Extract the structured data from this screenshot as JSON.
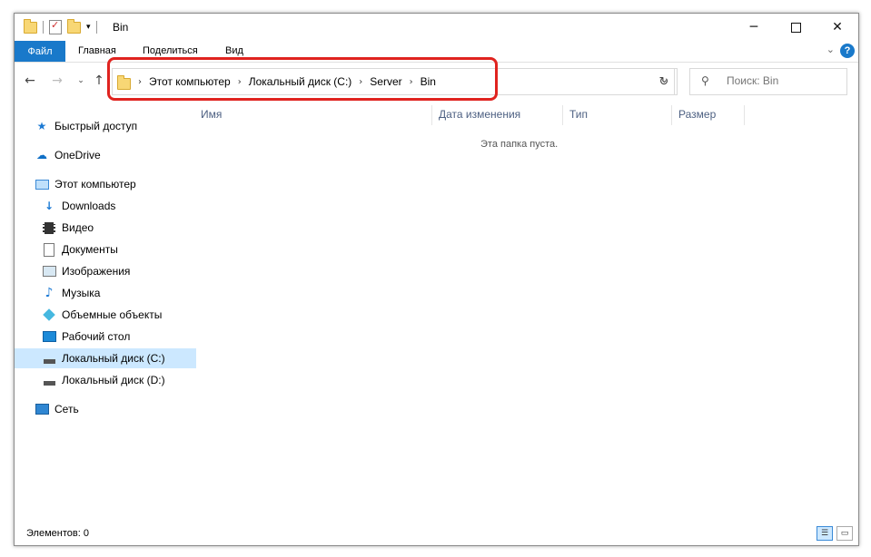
{
  "window": {
    "title": "Bin",
    "minimize_icon": "minimize-icon",
    "maximize_icon": "maximize-icon",
    "close_icon": "close-icon"
  },
  "ribbon": {
    "file_tab": "Файл",
    "tabs": [
      "Главная",
      "Поделиться",
      "Вид"
    ],
    "help_label": "?"
  },
  "address": {
    "crumbs": [
      "Этот компьютер",
      "Локальный диск (C:)",
      "Server",
      "Bin"
    ]
  },
  "search": {
    "placeholder": "Поиск: Bin"
  },
  "sidebar": {
    "items": [
      {
        "label": "Быстрый доступ",
        "icon": "star-icon"
      },
      {
        "label": "OneDrive",
        "icon": "cloud-icon"
      },
      {
        "label": "Этот компьютер",
        "icon": "computer-icon"
      },
      {
        "label": "Downloads",
        "icon": "download-icon"
      },
      {
        "label": "Видео",
        "icon": "video-icon"
      },
      {
        "label": "Документы",
        "icon": "document-icon"
      },
      {
        "label": "Изображения",
        "icon": "pictures-icon"
      },
      {
        "label": "Музыка",
        "icon": "music-icon"
      },
      {
        "label": "Объемные объекты",
        "icon": "3d-objects-icon"
      },
      {
        "label": "Рабочий стол",
        "icon": "desktop-icon"
      },
      {
        "label": "Локальный диск (C:)",
        "icon": "drive-icon",
        "selected": true
      },
      {
        "label": "Локальный диск (D:)",
        "icon": "drive-icon"
      },
      {
        "label": "Сеть",
        "icon": "network-icon"
      }
    ]
  },
  "columns": [
    "Имя",
    "Дата изменения",
    "Тип",
    "Размер"
  ],
  "content": {
    "empty_message": "Эта папка пуста."
  },
  "status": {
    "items_label": "Элементов: 0"
  },
  "colors": {
    "accent": "#1979ca",
    "highlight": "#e0231f",
    "selection": "#cce8ff"
  }
}
